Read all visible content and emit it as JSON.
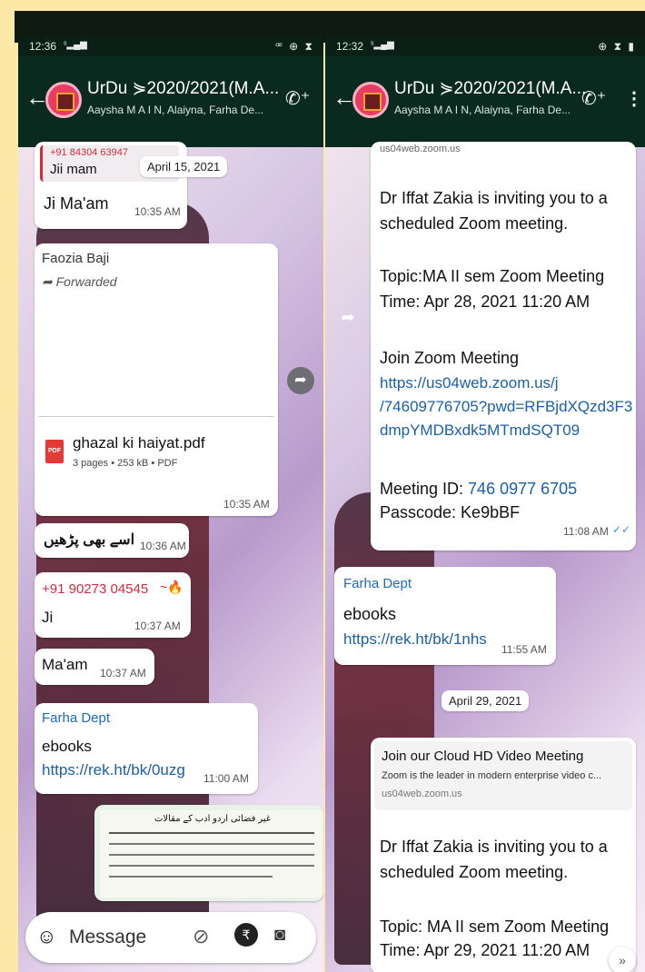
{
  "left": {
    "status_time": "12:36",
    "status_icons": "ꟹ ⊕ ⧗",
    "status_net": "ᵛᵒ",
    "header": {
      "title": "UrDu ⋟2020/2021(M.A...",
      "subtitle": "Aaysha M A I N, Alaiyna, Farha De..."
    },
    "quoted": {
      "number": "+91 84304 63947",
      "text": "Jii mam"
    },
    "date_chip": "April 15, 2021",
    "msg1": {
      "text": "Ji Ma'am",
      "time": "10:35 AM"
    },
    "doc": {
      "sender": "Faozia Baji",
      "forwarded": "Forwarded",
      "filename": "ghazal ki haiyat.pdf",
      "meta": "3 pages • 253 kB • PDF",
      "pdf_label": "PDF",
      "time": "10:35 AM"
    },
    "urdu": {
      "text": "اسے بھی پڑھیں",
      "time": "10:36 AM"
    },
    "phone_msg": {
      "number": "+91 90273 04545",
      "emoji": "~🔥",
      "text": "Ji",
      "time": "10:37 AM"
    },
    "maam": {
      "text": "Ma'am",
      "time": "10:37 AM"
    },
    "farha": {
      "sender": "Farha Dept",
      "text": "ebooks",
      "link": "https://rek.ht/bk/0uzg",
      "time": "11:00 AM"
    },
    "preview_heading": "غیر فضائی اردو ادب کے مقالات",
    "input_placeholder": "Message"
  },
  "right": {
    "status_time": "12:32",
    "status_icons": "⊕ ⧗ ▮",
    "header": {
      "title": "UrDu ⋟2020/2021(M.A...",
      "subtitle": "Aaysha M A I N, Alaiyna, Farha De..."
    },
    "top_cut": "us04web.zoom.us",
    "zoom1": {
      "line1": "Dr Iffat Zakia is inviting you to a",
      "line2": "scheduled Zoom meeting.",
      "topic": "Topic:MA II sem  Zoom Meeting",
      "time_line": "Time: Apr 28, 2021 11:20 AM",
      "join": "Join Zoom Meeting",
      "link1": "https://us04web.zoom.us/j",
      "link2": "/74609776705?pwd=RFBjdXQzd3F3",
      "link3": "dmpYMDBxdk5MTmdSQT09",
      "meeting_id_label": "Meeting ID: ",
      "meeting_id": "746 0977 6705",
      "passcode": "Passcode: Ke9bBF",
      "time": "11:08 AM",
      "ticks": "✓✓"
    },
    "farha": {
      "sender": "Farha Dept",
      "text": "ebooks",
      "link": "https://rek.ht/bk/1nhs",
      "time": "11:55 AM"
    },
    "date_chip": "April 29, 2021",
    "zoom2": {
      "preview_title": "Join our Cloud HD Video Meeting",
      "preview_desc": "Zoom is the leader in modern enterprise video c...",
      "preview_domain": "us04web.zoom.us",
      "line1": "Dr Iffat Zakia is inviting you to a",
      "line2": "scheduled Zoom meeting.",
      "topic": "Topic: MA II sem  Zoom Meeting",
      "time_line": "Time: Apr 29, 2021 11:20 AM"
    }
  }
}
